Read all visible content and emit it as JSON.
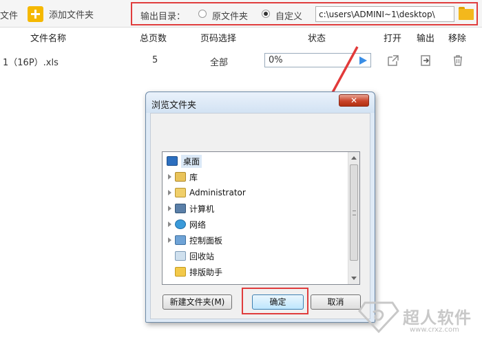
{
  "toolbar": {
    "left_fragment": "文件",
    "add_label": "添加文件夹",
    "output": {
      "label": "输出目录：",
      "option_original": "原文件夹",
      "option_custom": "自定义",
      "selected": "自定义",
      "path_value": "c:\\users\\ADMINI~1\\desktop\\"
    }
  },
  "table": {
    "headers": [
      "文件名称",
      "总页数",
      "页码选择",
      "状态",
      "打开",
      "输出",
      "移除"
    ],
    "rows": [
      {
        "name": "1（16P）.xls",
        "pages": "5",
        "page_select": "全部",
        "progress_text": "0%",
        "progress": 0
      }
    ]
  },
  "dialog": {
    "title": "浏览文件夹",
    "close_label": "✕",
    "tree": [
      {
        "label": "桌面",
        "icon": "desktop-icon",
        "expandable": false,
        "selected": true,
        "indent": 0
      },
      {
        "label": "库",
        "icon": "library-icon",
        "expandable": true,
        "indent": 1
      },
      {
        "label": "Administrator",
        "icon": "user-folder-icon",
        "expandable": true,
        "indent": 1
      },
      {
        "label": "计算机",
        "icon": "computer-icon",
        "expandable": true,
        "indent": 1
      },
      {
        "label": "网络",
        "icon": "network-icon",
        "expandable": true,
        "indent": 1
      },
      {
        "label": "控制面板",
        "icon": "control-panel-icon",
        "expandable": true,
        "indent": 1
      },
      {
        "label": "回收站",
        "icon": "recycle-bin-icon",
        "expandable": false,
        "indent": 1
      },
      {
        "label": "排版助手",
        "icon": "folder-icon",
        "expandable": false,
        "indent": 1
      }
    ],
    "buttons": {
      "new_folder": "新建文件夹(M)",
      "ok": "确定",
      "cancel": "取消"
    }
  },
  "watermark": {
    "brand": "超人软件",
    "url": "www.crxz.com"
  },
  "colors": {
    "highlight_red": "#e03c3c",
    "accent_blue": "#3a8ee6",
    "folder_yellow": "#f3b81c"
  }
}
